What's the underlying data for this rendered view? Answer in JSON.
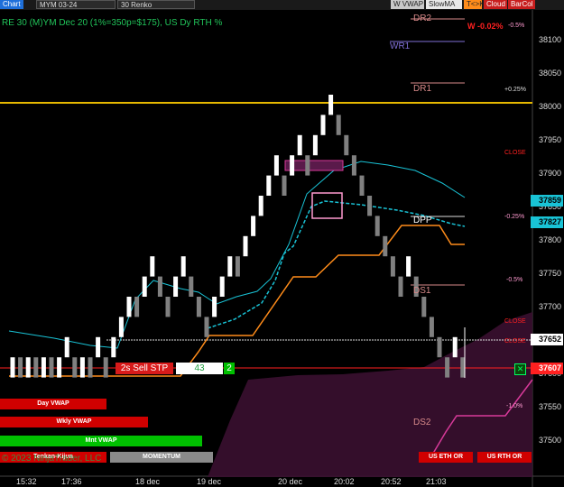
{
  "toolbar": {
    "chart_tab": "Chart",
    "instrument": "MYM 03-24",
    "bar_type": "30 Renko",
    "btn_wvwap": "W VWAP",
    "btn_slowma": "SlowMA",
    "btn_tk": "T<>K",
    "btn_cloud": "Cloud",
    "btn_barcol": "BarCol"
  },
  "header": {
    "title": "RE 30 (M)YM Dec 20 (1%=350p=$175), US Dy RTH %",
    "change": "W -0.02%",
    "change_small": "-0.5%"
  },
  "levels": {
    "dr2": "DR2",
    "wr1": "WR1",
    "dr1": "DR1",
    "dpp": "DPP",
    "ds1": "DS1",
    "ds2": "DS2"
  },
  "right_notes": {
    "p025": "+0.25%",
    "close1": "CLOSE",
    "m025": "-0.25%",
    "m05": "-0.5%",
    "close2": "CLOSE",
    "close3": "CLOSE",
    "m1": "-1.0%"
  },
  "price_boxes": {
    "b1": "37859",
    "b2": "37827",
    "b3": "37652",
    "b4": "37607"
  },
  "order": {
    "label": "2s  Sell STP",
    "qty": "43",
    "num": "2",
    "close_x": "✕"
  },
  "bottom_buttons": {
    "day_vwap": "Day VWAP",
    "wkly_vwap": "Wkly VWAP",
    "mnt_vwap": "Mnt VWAP",
    "tenkan": "Tenkan-Kijun",
    "momentum": "MOMENTUM",
    "us_eth_or": "US ETH OR",
    "us_rth_or": "US RTH OR"
  },
  "copyright": "© 2023 NinjaTrader, LLC",
  "colors": {
    "background": "#000000",
    "up_bar": "#ffffff",
    "down_bar": "#808080",
    "yellow_line": "#e6b800",
    "orange_line": "#ff8c1a",
    "cyan_line": "#19c3d6",
    "magenta": "#d83a9a",
    "red_line": "#ff2020",
    "cloud": "#3a1030",
    "vwap_day": "#d00000",
    "vwap_month": "#00c000"
  },
  "chart_data": {
    "type": "candlestick",
    "y_axis": {
      "ticks": [
        38100,
        38050,
        38000,
        37950,
        37900,
        37850,
        37800,
        37750,
        37700,
        37650,
        37600,
        37550,
        37500
      ],
      "range": [
        37470,
        38125
      ]
    },
    "x_axis": {
      "ticks": [
        "15:32",
        "17:36",
        "18 dec",
        "19 dec",
        "20 dec",
        "20:02",
        "20:52",
        "21:03"
      ]
    },
    "renko_bars": [
      [
        37597,
        37627,
        1
      ],
      [
        37597,
        37627,
        0
      ],
      [
        37597,
        37627,
        1
      ],
      [
        37597,
        37627,
        0
      ],
      [
        37597,
        37627,
        1
      ],
      [
        37597,
        37627,
        0
      ],
      [
        37597,
        37627,
        1
      ],
      [
        37627,
        37657,
        1
      ],
      [
        37597,
        37627,
        0
      ],
      [
        37597,
        37627,
        1
      ],
      [
        37597,
        37627,
        0
      ],
      [
        37627,
        37657,
        1
      ],
      [
        37597,
        37627,
        0
      ],
      [
        37627,
        37657,
        1
      ],
      [
        37657,
        37687,
        1
      ],
      [
        37687,
        37717,
        1
      ],
      [
        37687,
        37717,
        0
      ],
      [
        37717,
        37747,
        1
      ],
      [
        37747,
        37777,
        1
      ],
      [
        37717,
        37747,
        0
      ],
      [
        37687,
        37717,
        0
      ],
      [
        37717,
        37747,
        1
      ],
      [
        37747,
        37777,
        1
      ],
      [
        37717,
        37747,
        0
      ],
      [
        37687,
        37717,
        0
      ],
      [
        37657,
        37687,
        0
      ],
      [
        37687,
        37717,
        1
      ],
      [
        37717,
        37747,
        1
      ],
      [
        37747,
        37777,
        1
      ],
      [
        37747,
        37777,
        0
      ],
      [
        37777,
        37807,
        1
      ],
      [
        37807,
        37837,
        1
      ],
      [
        37837,
        37867,
        1
      ],
      [
        37867,
        37897,
        1
      ],
      [
        37897,
        37927,
        1
      ],
      [
        37867,
        37897,
        0
      ],
      [
        37897,
        37927,
        1
      ],
      [
        37927,
        37957,
        1
      ],
      [
        37897,
        37927,
        0
      ],
      [
        37927,
        37957,
        1
      ],
      [
        37957,
        37987,
        1
      ],
      [
        37987,
        38017,
        1
      ],
      [
        37957,
        37987,
        0
      ],
      [
        37927,
        37957,
        0
      ],
      [
        37897,
        37927,
        0
      ],
      [
        37867,
        37897,
        0
      ],
      [
        37837,
        37867,
        0
      ],
      [
        37807,
        37837,
        0
      ],
      [
        37777,
        37807,
        0
      ],
      [
        37747,
        37777,
        0
      ],
      [
        37717,
        37747,
        0
      ],
      [
        37747,
        37777,
        1
      ],
      [
        37717,
        37747,
        0
      ],
      [
        37687,
        37717,
        0
      ],
      [
        37657,
        37687,
        0
      ],
      [
        37627,
        37657,
        0
      ],
      [
        37597,
        37627,
        0
      ],
      [
        37627,
        37657,
        1
      ],
      [
        37597,
        37627,
        0
      ]
    ]
  }
}
